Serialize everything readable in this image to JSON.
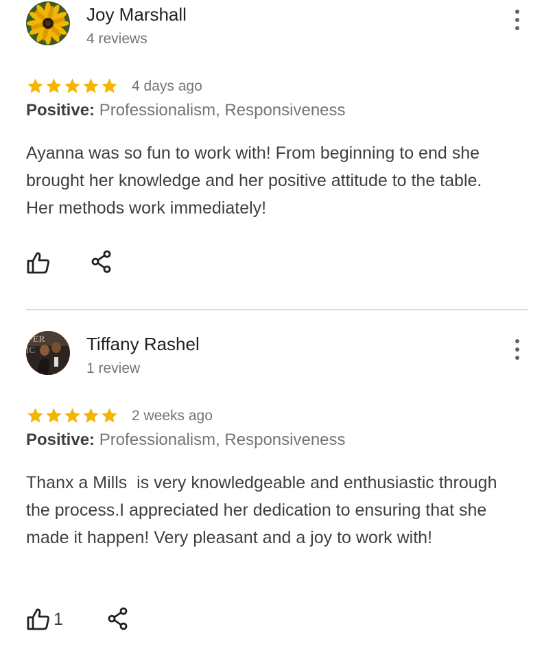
{
  "reviews": [
    {
      "author": "Joy Marshall",
      "review_count": "4 reviews",
      "rating": 5,
      "date": "4 days ago",
      "positive_label": "Positive:",
      "positive_values": "Professionalism, Responsiveness",
      "text": "Ayanna was so fun to work with! From beginning to end she brought her knowledge and her positive attitude to the table. Her methods work immediately!",
      "like_count": "",
      "avatar_icon": "sunflower-avatar"
    },
    {
      "author": "Tiffany Rashel",
      "review_count": "1 review",
      "rating": 5,
      "date": "2 weeks ago",
      "positive_label": "Positive:",
      "positive_values": "Professionalism, Responsiveness",
      "text": "Thanx a Mills  is very knowledgeable and enthusiastic through the process.I appreciated her dedication to ensuring that she made it happen! Very pleasant and a joy to work with!",
      "like_count": "1",
      "avatar_icon": "photo-avatar"
    }
  ],
  "colors": {
    "star": "#F4B400",
    "icon": "#202124",
    "divider": "#dadce0"
  },
  "icons": {
    "like": "thumbs-up-icon",
    "share": "share-icon",
    "more": "more-vert-icon"
  }
}
